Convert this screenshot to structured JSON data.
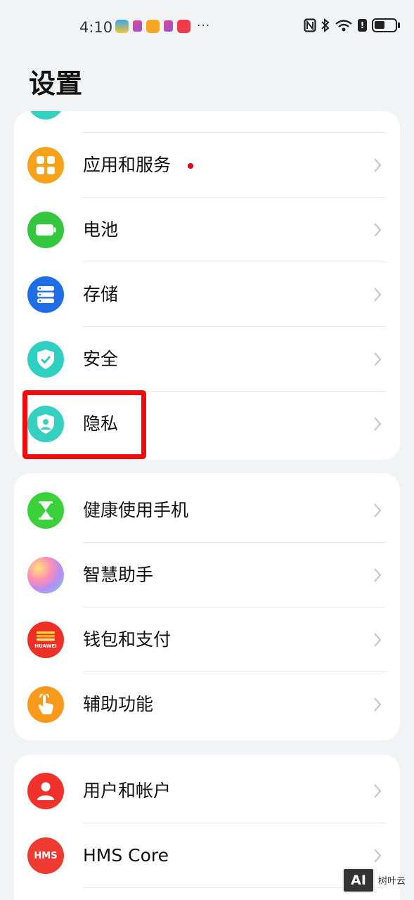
{
  "status_bar": {
    "time": "4:10",
    "more_indicator": "···",
    "battery_level": 0.35,
    "icons": [
      "nfc-icon",
      "bluetooth-icon",
      "wifi-icon",
      "alert-icon",
      "battery-icon"
    ]
  },
  "page": {
    "title": "设置"
  },
  "sections": [
    {
      "items": [
        {
          "label": "应用和服务",
          "icon": "apps-icon",
          "color": "#f7a21b",
          "has_badge": true
        },
        {
          "label": "电池",
          "icon": "battery-setting-icon",
          "color": "#34c63f"
        },
        {
          "label": "存储",
          "icon": "storage-icon",
          "color": "#1f6ee8"
        },
        {
          "label": "安全",
          "icon": "shield-check-icon",
          "color": "#2fcfc2"
        },
        {
          "label": "隐私",
          "icon": "privacy-icon",
          "color": "#35d0c0",
          "highlighted": true
        }
      ]
    },
    {
      "items": [
        {
          "label": "健康使用手机",
          "icon": "hourglass-icon",
          "color": "#3bd13b"
        },
        {
          "label": "智慧助手",
          "icon": "assistant-orb-icon",
          "color": "#b98cf0"
        },
        {
          "label": "钱包和支付",
          "icon": "wallet-icon",
          "color": "#ef2e25",
          "icon_text": "HUAWEI"
        },
        {
          "label": "辅助功能",
          "icon": "accessibility-hand-icon",
          "color": "#f99a1c"
        }
      ]
    },
    {
      "items": [
        {
          "label": "用户和帐户",
          "icon": "user-icon",
          "color": "#f0322b"
        },
        {
          "label": "HMS Core",
          "icon": "hms-icon",
          "color": "#ef3a32",
          "icon_text": "HMS"
        }
      ]
    }
  ],
  "watermark": {
    "logo": "AI",
    "text": "树叶云"
  },
  "colors": {
    "background": "#f1f3f5",
    "card": "#ffffff",
    "highlight": "#f00c0c"
  }
}
